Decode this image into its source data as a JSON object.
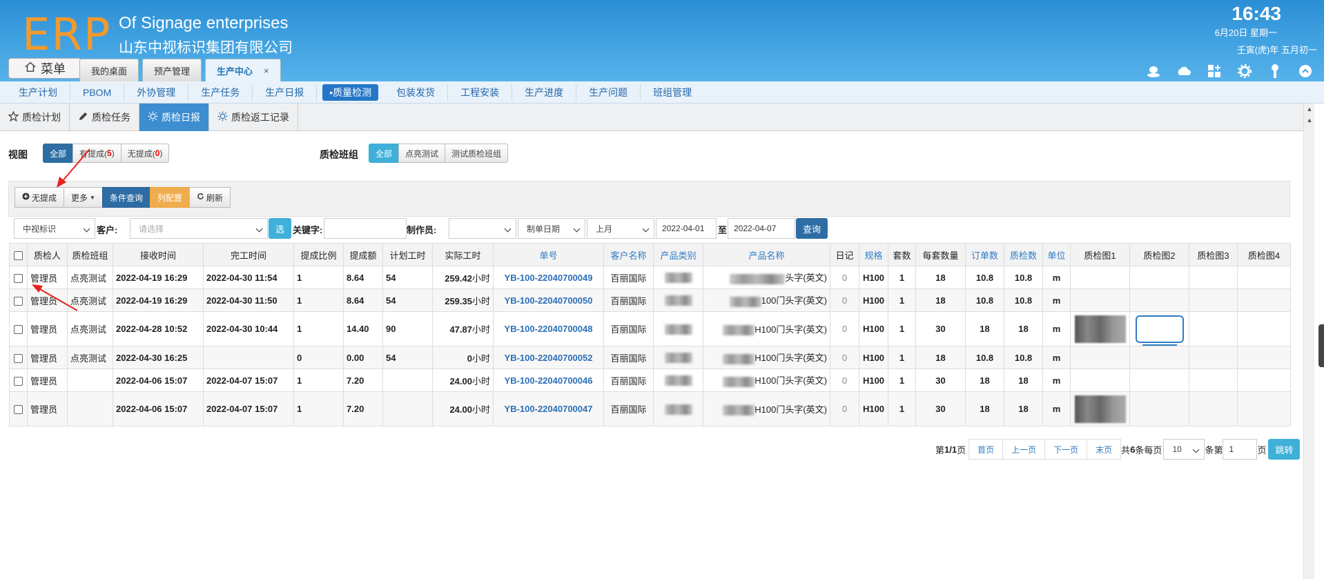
{
  "header": {
    "logo": "ERP",
    "company_en": "Of Signage enterprises",
    "company_cn": "山东中视标识集团有限公司",
    "time": "16:43",
    "date": "6月20日 星期一",
    "lunar": "壬寅(虎)年 五月初一"
  },
  "menu_label": "菜单",
  "tabs": [
    {
      "label": "我的桌面"
    },
    {
      "label": "预产管理"
    },
    {
      "label": "生产中心",
      "close": "×"
    }
  ],
  "modules": [
    "生产计划",
    "PBOM",
    "外协管理",
    "生产任务",
    "生产日报",
    "•质量检测",
    "包装发货",
    "工程安装",
    "生产进度",
    "生产问题",
    "班组管理"
  ],
  "subtabs": [
    "质检计划",
    "质检任务",
    "质检日报",
    "质检返工记录"
  ],
  "filters": {
    "view_label": "视图",
    "view_all": "全部",
    "view_has": "有提成(",
    "view_has_count": "5",
    "view_none": "无提成(",
    "view_none_count": "0",
    "close_paren": ")",
    "group_label": "质检班组",
    "group_all": "全部",
    "group_1": "点亮测试",
    "group_2": "测试质检班组"
  },
  "toolbar": {
    "no_commission": "无提成",
    "more": "更多",
    "condition_query": "条件查询",
    "column_config": "列配置",
    "refresh": "刷新"
  },
  "search": {
    "company": "中视标识",
    "customer_label": "客户:",
    "customer_placeholder": "请选择",
    "select_btn": "选",
    "keyword_label": "关键字:",
    "maker_label": "制作员:",
    "date_type": "制单日期",
    "period": "上月",
    "date_from": "2022-04-01",
    "to": "至",
    "date_to": "2022-04-07",
    "query": "查询"
  },
  "table": {
    "columns": [
      "质检人",
      "质检班组",
      "接收时间",
      "完工时间",
      "提成比例",
      "提成额",
      "计划工时",
      "实际工时",
      "单号",
      "客户名称",
      "产品类别",
      "产品名称",
      "日记",
      "规格",
      "套数",
      "每套数量",
      "订单数",
      "质检数",
      "单位",
      "质检图1",
      "质检图2",
      "质检图3",
      "质检图4"
    ],
    "rows": [
      {
        "inspector": "管理员",
        "group": "点亮测试",
        "recv": "2022-04-19 16:29",
        "done": "2022-04-30 11:54",
        "ratio": "1",
        "amount": "8.64",
        "plan": "54",
        "actual": "259.42",
        "unit_h": "小时",
        "no": "YB-100-22040700049",
        "customer": "百丽国际",
        "pname": "头字(英文)",
        "diary": "0",
        "spec": "H100",
        "sets": "1",
        "per": "18",
        "orders": "10.8",
        "qc": "10.8",
        "unit": "m"
      },
      {
        "inspector": "管理员",
        "group": "点亮测试",
        "recv": "2022-04-19 16:29",
        "done": "2022-04-30 11:50",
        "ratio": "1",
        "amount": "8.64",
        "plan": "54",
        "actual": "259.35",
        "unit_h": "小时",
        "no": "YB-100-22040700050",
        "customer": "百丽国际",
        "pname": "100门头字(英文)",
        "diary": "0",
        "spec": "H100",
        "sets": "1",
        "per": "18",
        "orders": "10.8",
        "qc": "10.8",
        "unit": "m"
      },
      {
        "inspector": "管理员",
        "group": "点亮测试",
        "recv": "2022-04-28 10:52",
        "done": "2022-04-30 10:44",
        "ratio": "1",
        "amount": "14.40",
        "plan": "90",
        "actual": "47.87",
        "unit_h": "小时",
        "no": "YB-100-22040700048",
        "customer": "百丽国际",
        "pname": "H100门头字(英文)",
        "diary": "0",
        "spec": "H100",
        "sets": "1",
        "per": "30",
        "orders": "18",
        "qc": "18",
        "unit": "m"
      },
      {
        "inspector": "管理员",
        "group": "点亮测试",
        "recv": "2022-04-30 16:25",
        "done": "",
        "ratio": "0",
        "amount": "0.00",
        "plan": "54",
        "actual": "0",
        "unit_h": "小时",
        "no": "YB-100-22040700052",
        "customer": "百丽国际",
        "pname": "H100门头字(英文)",
        "diary": "0",
        "spec": "H100",
        "sets": "1",
        "per": "18",
        "orders": "10.8",
        "qc": "10.8",
        "unit": "m"
      },
      {
        "inspector": "管理员",
        "group": "",
        "recv": "2022-04-06 15:07",
        "done": "2022-04-07 15:07",
        "ratio": "1",
        "amount": "7.20",
        "plan": "",
        "actual": "24.00",
        "unit_h": "小时",
        "no": "YB-100-22040700046",
        "customer": "百丽国际",
        "pname": "H100门头字(英文)",
        "diary": "0",
        "spec": "H100",
        "sets": "1",
        "per": "30",
        "orders": "18",
        "qc": "18",
        "unit": "m"
      },
      {
        "inspector": "管理员",
        "group": "",
        "recv": "2022-04-06 15:07",
        "done": "2022-04-07 15:07",
        "ratio": "1",
        "amount": "7.20",
        "plan": "",
        "actual": "24.00",
        "unit_h": "小时",
        "no": "YB-100-22040700047",
        "customer": "百丽国际",
        "pname": "H100门头字(英文)",
        "diary": "0",
        "spec": "H100",
        "sets": "1",
        "per": "30",
        "orders": "18",
        "qc": "18",
        "unit": "m"
      }
    ]
  },
  "pager": {
    "page_prefix": "第",
    "page_value": "1/1",
    "page_suffix": "页",
    "first": "首页",
    "prev": "上一页",
    "next": "下一页",
    "last": "末页",
    "total_prefix": "共",
    "total": "6",
    "per_page_label": "条每页",
    "per_page": "10",
    "goto_prefix": "条第",
    "goto_value": "1",
    "goto_suffix": "页",
    "jump": "跳转"
  },
  "colors": {
    "header": "#3fa0e0",
    "accent": "#2e6da4",
    "link": "#2a6fb8",
    "orange": "#f0ad4e",
    "logo": "#f39a2c"
  }
}
